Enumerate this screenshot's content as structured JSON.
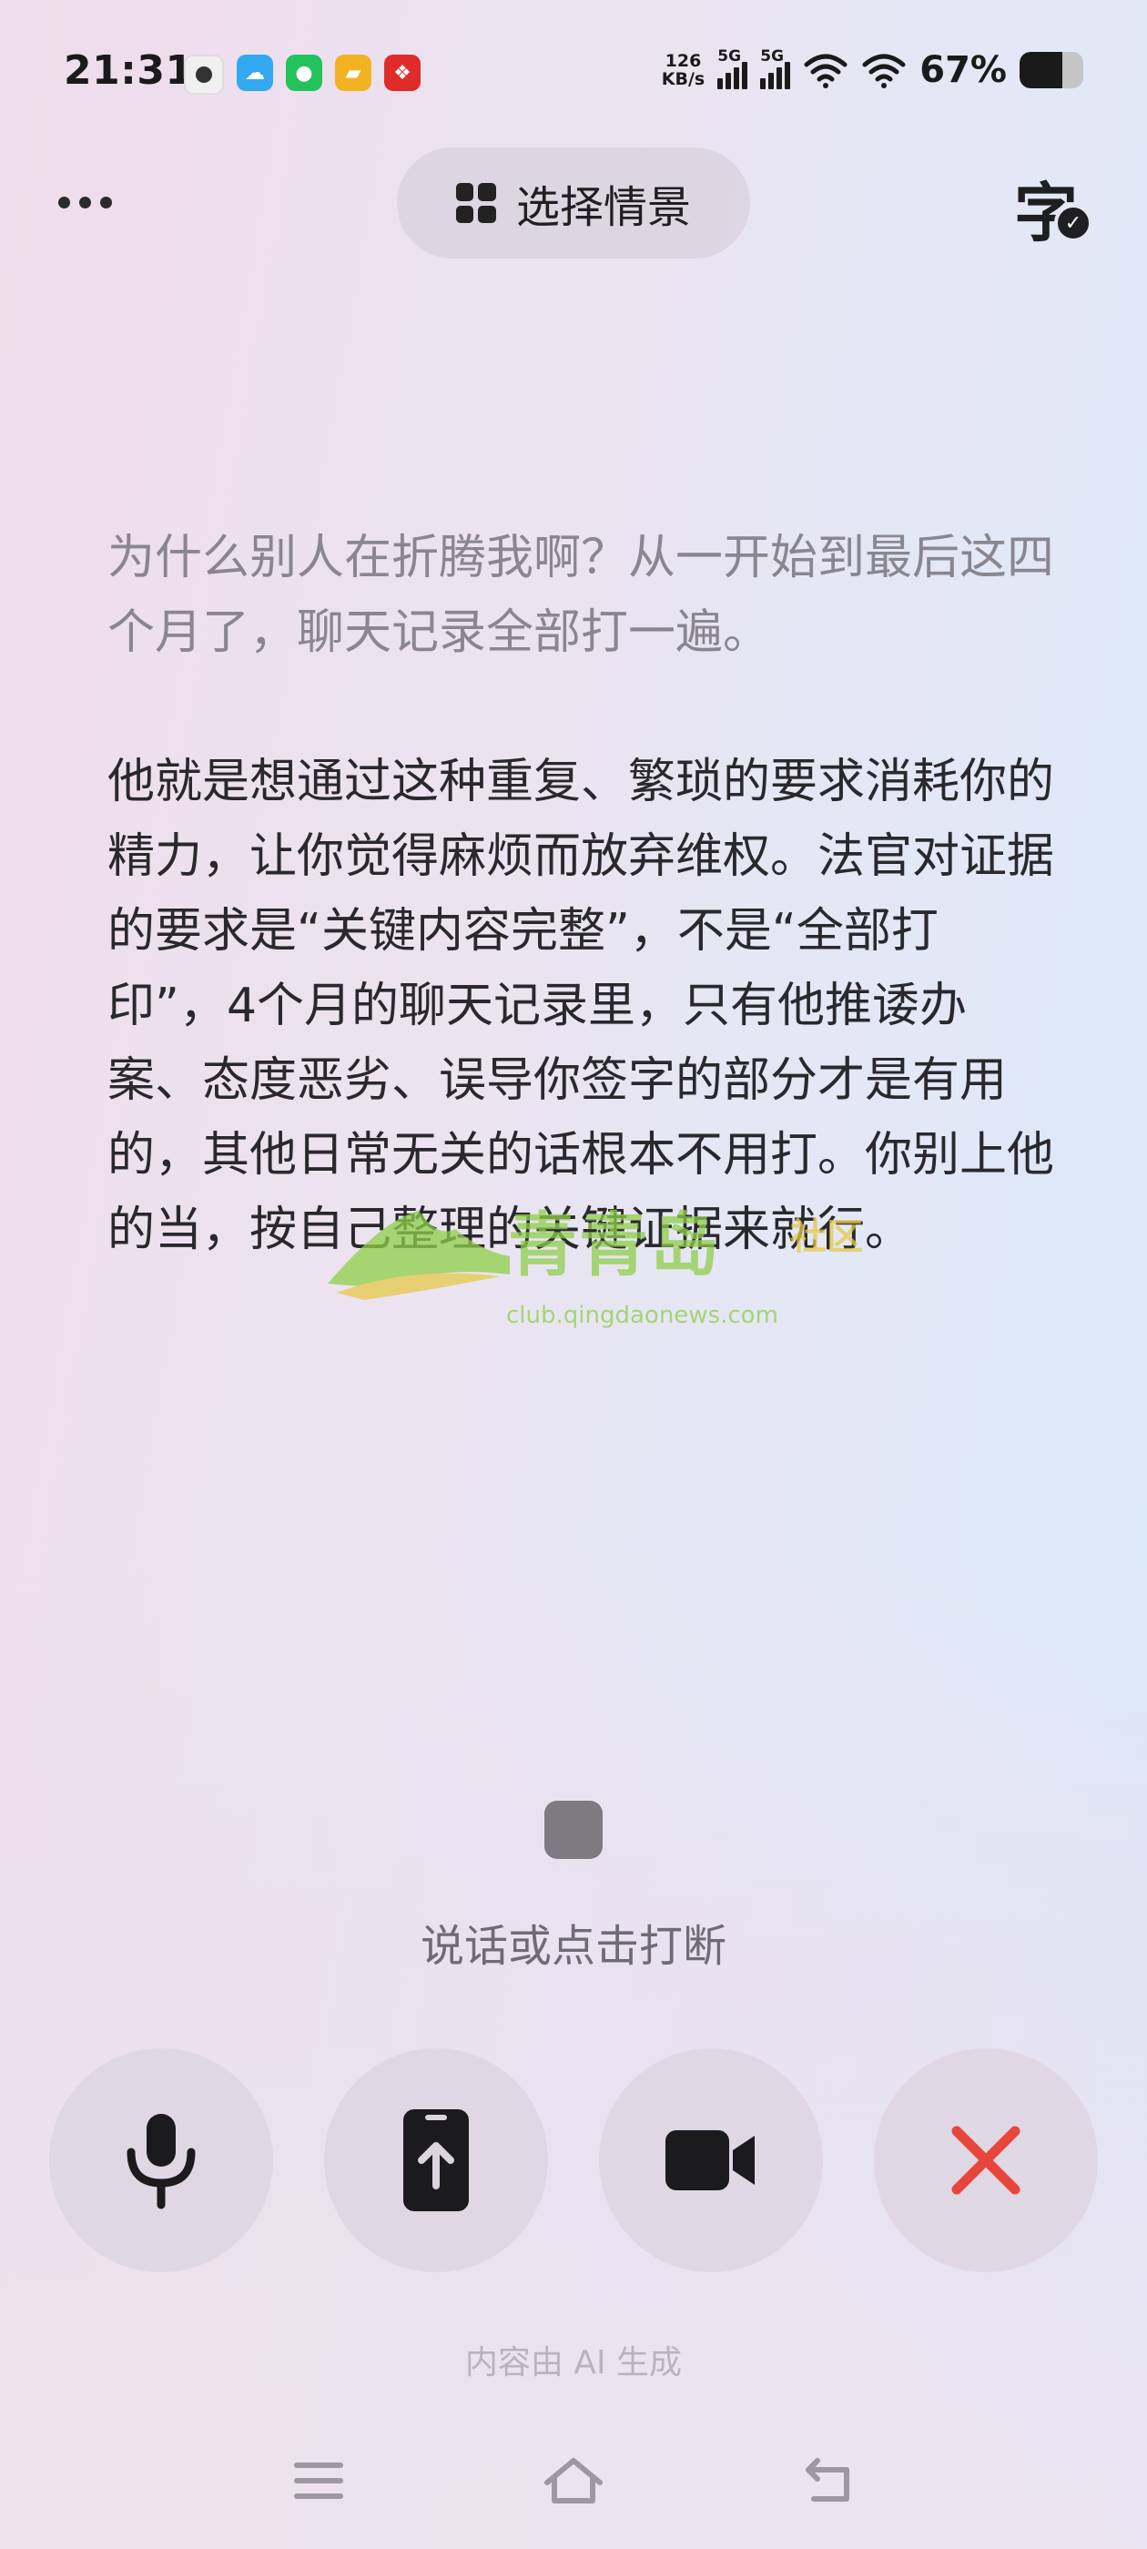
{
  "status_bar": {
    "time": "21:31",
    "net_speed_value": "126",
    "net_speed_unit": "KB/s",
    "signal1_label": "5G",
    "signal2_label": "5G",
    "battery_percent": "67%",
    "battery_level": 0.67,
    "notification_icons": [
      "avatar-icon",
      "cloud-app-icon",
      "wechat-icon",
      "folder-app-icon",
      "red-app-icon"
    ]
  },
  "header": {
    "more_icon": "more-dots-icon",
    "scene_button_label": "选择情景",
    "scene_icon": "grid-icon",
    "subtitle_toggle_char": "字",
    "subtitle_check": "✓"
  },
  "transcript": {
    "user_question": "为什么别人在折腾我啊？从一开始到最后这四个月了，聊天记录全部打一遍。",
    "ai_answer": "他就是想通过这种重复、繁琐的要求消耗你的精力，让你觉得麻烦而放弃维权。法官对证据的要求是“关键内容完整”，不是“全部打印”，4个月的聊天记录里，只有他推诿办案、态度恶劣、误导你签字的部分才是有用的，其他日常无关的话根本不用打。你别上他的当，按自己整理的关键证据来就行。"
  },
  "watermark": {
    "name": "青青岛",
    "suffix": "社区",
    "url": "club.qingdaonews.com"
  },
  "interaction": {
    "hint": "说话或点击打断"
  },
  "controls": {
    "mic_icon": "microphone-icon",
    "upload_icon": "phone-upload-icon",
    "video_icon": "video-camera-icon",
    "close_icon": "close-icon",
    "close_color": "#e8453c"
  },
  "footer": {
    "ai_note": "内容由 AI 生成"
  },
  "nav_bar": {
    "menu_icon": "menu-icon",
    "home_icon": "home-icon",
    "back_icon": "back-icon"
  }
}
